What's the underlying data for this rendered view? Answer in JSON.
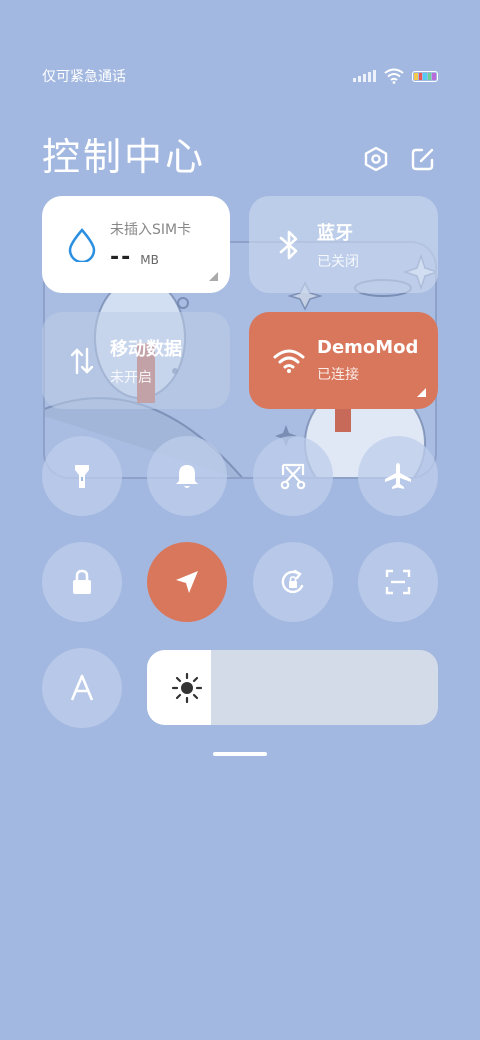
{
  "status_bar": {
    "carrier": "仅可紧急通话",
    "icons": [
      "signal-icon",
      "wifi-icon",
      "battery-icon"
    ]
  },
  "header": {
    "title": "控制中心",
    "icons": [
      "settings-icon",
      "edit-icon"
    ]
  },
  "tiles": {
    "data_usage": {
      "title": "未插入SIM卡",
      "value": "--",
      "unit": "MB",
      "icon": "water-drop-icon"
    },
    "bluetooth": {
      "title": "蓝牙",
      "status": "已关闭",
      "icon": "bluetooth-icon"
    },
    "mobile_data": {
      "title": "移动数据",
      "status": "未开启",
      "icon": "data-arrows-icon"
    },
    "wifi": {
      "title": "DemoMod",
      "status": "已连接",
      "icon": "wifi-icon"
    }
  },
  "toggles": [
    {
      "name": "flashlight",
      "icon": "flashlight-icon",
      "active": false
    },
    {
      "name": "bell",
      "icon": "bell-icon",
      "active": false
    },
    {
      "name": "screenshot",
      "icon": "scissors-icon",
      "active": false
    },
    {
      "name": "airplane",
      "icon": "airplane-icon",
      "active": false
    },
    {
      "name": "lock",
      "icon": "lock-icon",
      "active": false
    },
    {
      "name": "location",
      "icon": "location-arrow-icon",
      "active": true
    },
    {
      "name": "rotation",
      "icon": "rotation-lock-icon",
      "active": false
    },
    {
      "name": "scanner",
      "icon": "scan-icon",
      "active": false
    },
    {
      "name": "font",
      "icon": "font-a-icon",
      "active": false
    }
  ],
  "brightness": {
    "level": 0.22,
    "icon": "sun-icon"
  },
  "colors": {
    "background": "#a3b8e0",
    "accent": "#d9775c",
    "data_icon": "#2a8fe0"
  }
}
